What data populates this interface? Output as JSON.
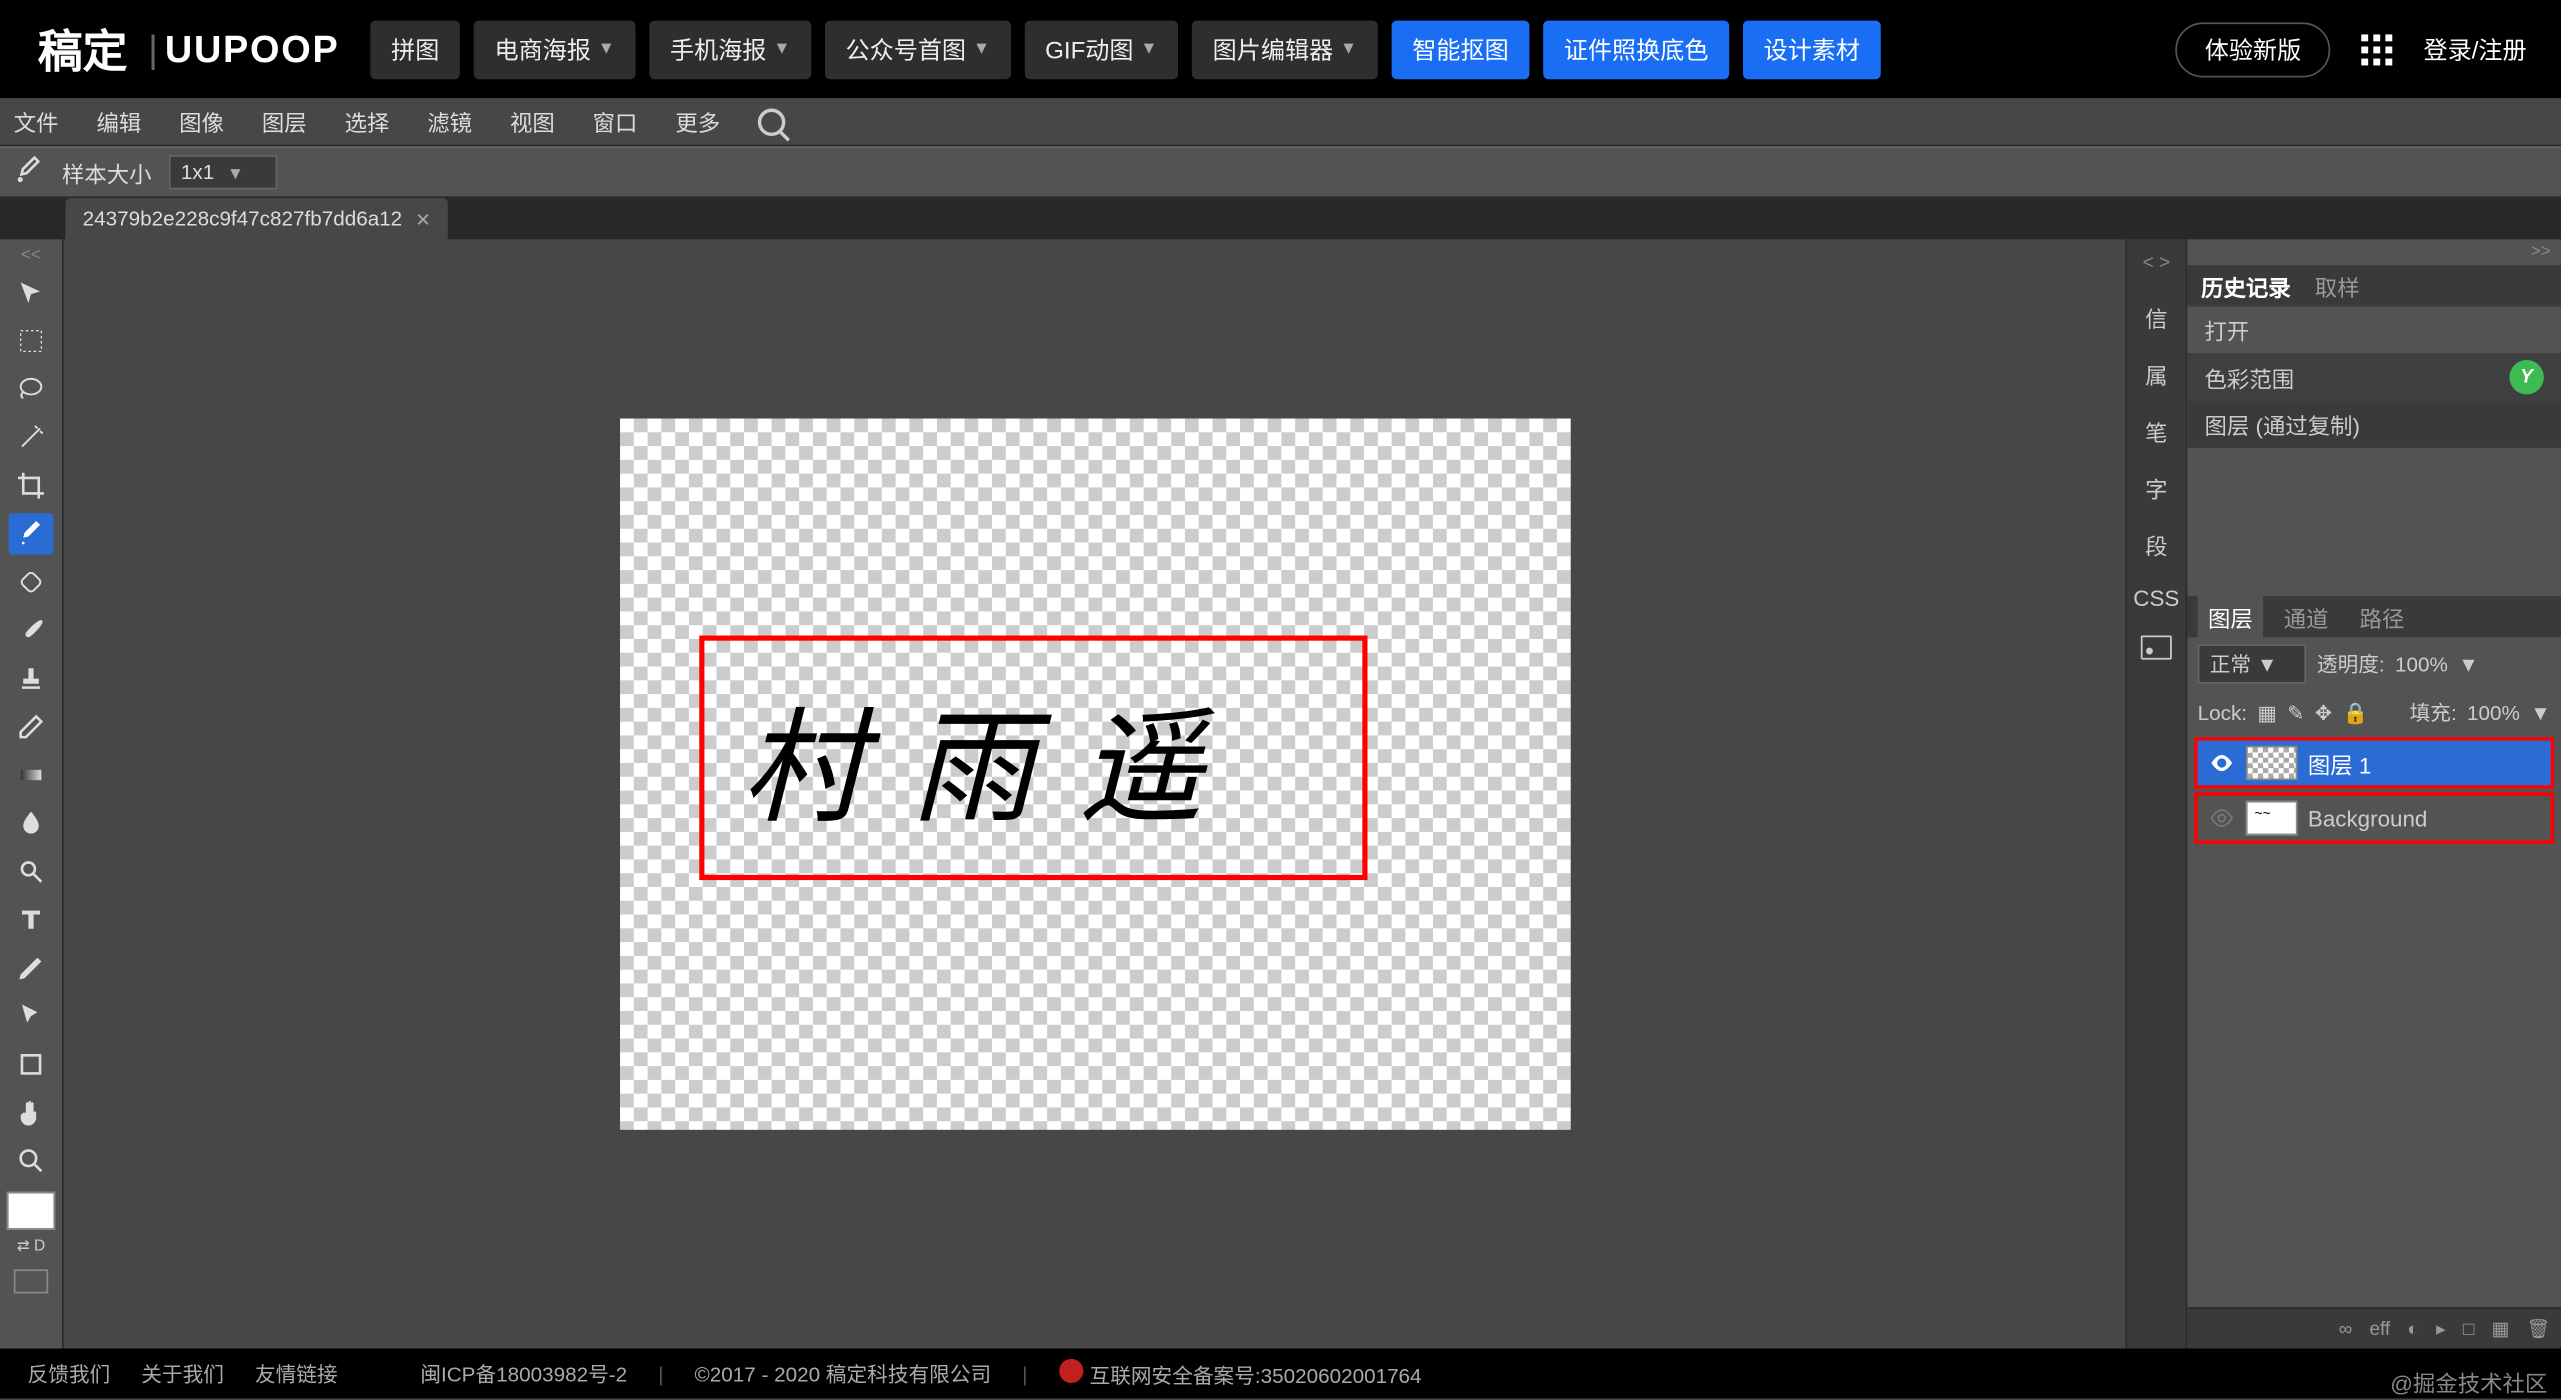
{
  "header": {
    "logo1": "稿定",
    "logo2": "UUPOOP",
    "nav": [
      {
        "label": "拼图",
        "dropdown": false,
        "blue": false
      },
      {
        "label": "电商海报",
        "dropdown": true,
        "blue": false
      },
      {
        "label": "手机海报",
        "dropdown": true,
        "blue": false
      },
      {
        "label": "公众号首图",
        "dropdown": true,
        "blue": false
      },
      {
        "label": "GIF动图",
        "dropdown": true,
        "blue": false
      },
      {
        "label": "图片编辑器",
        "dropdown": true,
        "blue": false
      },
      {
        "label": "智能抠图",
        "dropdown": false,
        "blue": true
      },
      {
        "label": "证件照换底色",
        "dropdown": false,
        "blue": true
      },
      {
        "label": "设计素材",
        "dropdown": false,
        "blue": true
      }
    ],
    "try_new": "体验新版",
    "login": "登录/注册"
  },
  "menubar": [
    "文件",
    "编辑",
    "图像",
    "图层",
    "选择",
    "滤镜",
    "视图",
    "窗口",
    "更多"
  ],
  "optionsbar": {
    "sample_label": "样本大小",
    "sample_value": "1x1"
  },
  "tab": {
    "name": "24379b2e228c9f47c827fb7dd6a12"
  },
  "canvas_text": "村 雨 遥",
  "right_tabs": [
    "信",
    "属",
    "笔",
    "字",
    "段",
    "CSS"
  ],
  "panels": {
    "history_tabs": [
      "历史记录",
      "取样"
    ],
    "history_active": 0,
    "history_items": [
      {
        "label": "打开",
        "badge": false
      },
      {
        "label": "色彩范围",
        "badge": true
      },
      {
        "label": "图层 (通过复制)",
        "badge": false
      }
    ],
    "layer_tabs": [
      "图层",
      "通道",
      "路径"
    ],
    "layer_tabs_active": 0,
    "blend_mode": "正常",
    "opacity_label": "透明度:",
    "opacity_value": "100%",
    "lock_label": "Lock:",
    "fill_label": "填充:",
    "fill_value": "100%",
    "layers": [
      {
        "name": "图层 1",
        "visible": true,
        "selected": true,
        "thumb": "checker"
      },
      {
        "name": "Background",
        "visible": false,
        "selected": false,
        "thumb": "white"
      }
    ],
    "footer_icons": [
      "∞",
      "eff",
      "◐",
      "▸",
      "□",
      "▦",
      "🗑"
    ]
  },
  "footer": {
    "links": [
      "反馈我们",
      "关于我们",
      "友情链接"
    ],
    "icp": "闽ICP备18003982号-2",
    "copyright": "©2017 - 2020 稿定科技有限公司",
    "beian": "互联网安全备案号:35020602001764"
  },
  "watermark": "@掘金技术社区"
}
